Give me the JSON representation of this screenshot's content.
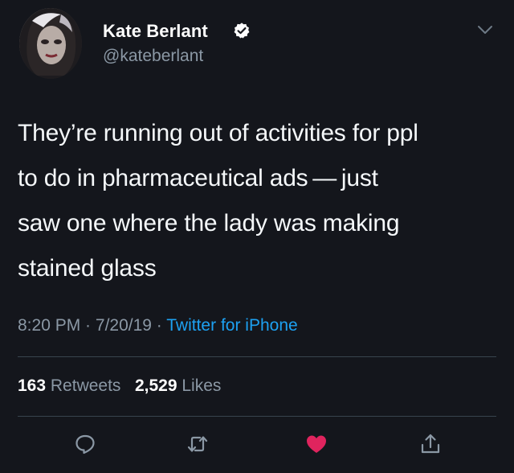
{
  "user": {
    "display_name": "Kate Berlant",
    "handle": "@kateberlant",
    "verified": true
  },
  "tweet": {
    "text_lines": [
      "They’re running out of activities for ppl",
      "to do in pharmaceutical ads — just",
      "saw one where the lady was making",
      "stained glass"
    ],
    "time": "8:20 PM",
    "sep1": " · ",
    "date": "7/20/19",
    "sep2": " · ",
    "source": "Twitter for iPhone"
  },
  "stats": {
    "retweets_count": "163",
    "retweets_label": "Retweets",
    "likes_count": "2,529",
    "likes_label": "Likes"
  },
  "actions": {
    "reply_icon": "reply-icon",
    "retweet_icon": "retweet-icon",
    "like_icon": "heart-icon",
    "share_icon": "share-icon",
    "liked": true
  },
  "colors": {
    "background": "#14161c",
    "text": "#f5f8fa",
    "secondary": "#8b98a5",
    "link": "#1da1f2",
    "like": "#e0245e"
  }
}
